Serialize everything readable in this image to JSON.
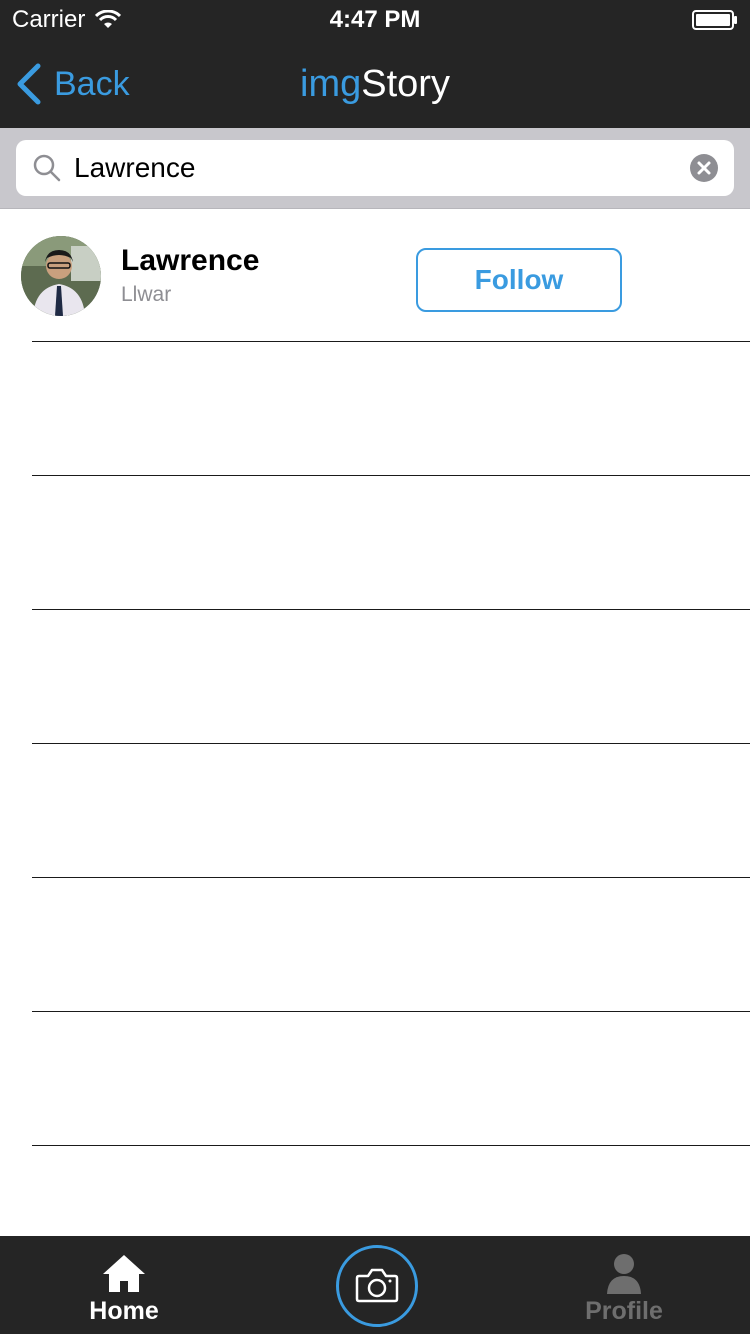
{
  "status_bar": {
    "carrier": "Carrier",
    "time": "4:47 PM",
    "wifi_icon": "wifi-icon",
    "battery_icon": "battery-icon"
  },
  "nav": {
    "back_label": "Back",
    "title_part1": "img",
    "title_part2": "Story"
  },
  "search": {
    "value": "Lawrence",
    "placeholder": ""
  },
  "results": [
    {
      "name": "Lawrence",
      "handle": "Llwar",
      "follow_label": "Follow"
    }
  ],
  "tab_bar": {
    "home_label": "Home",
    "profile_label": "Profile",
    "camera_icon": "camera-icon"
  },
  "colors": {
    "accent": "#3a9be0",
    "bar_background": "#252525",
    "search_background": "#c8c7cc",
    "inactive_tab": "#6e6e6e"
  }
}
